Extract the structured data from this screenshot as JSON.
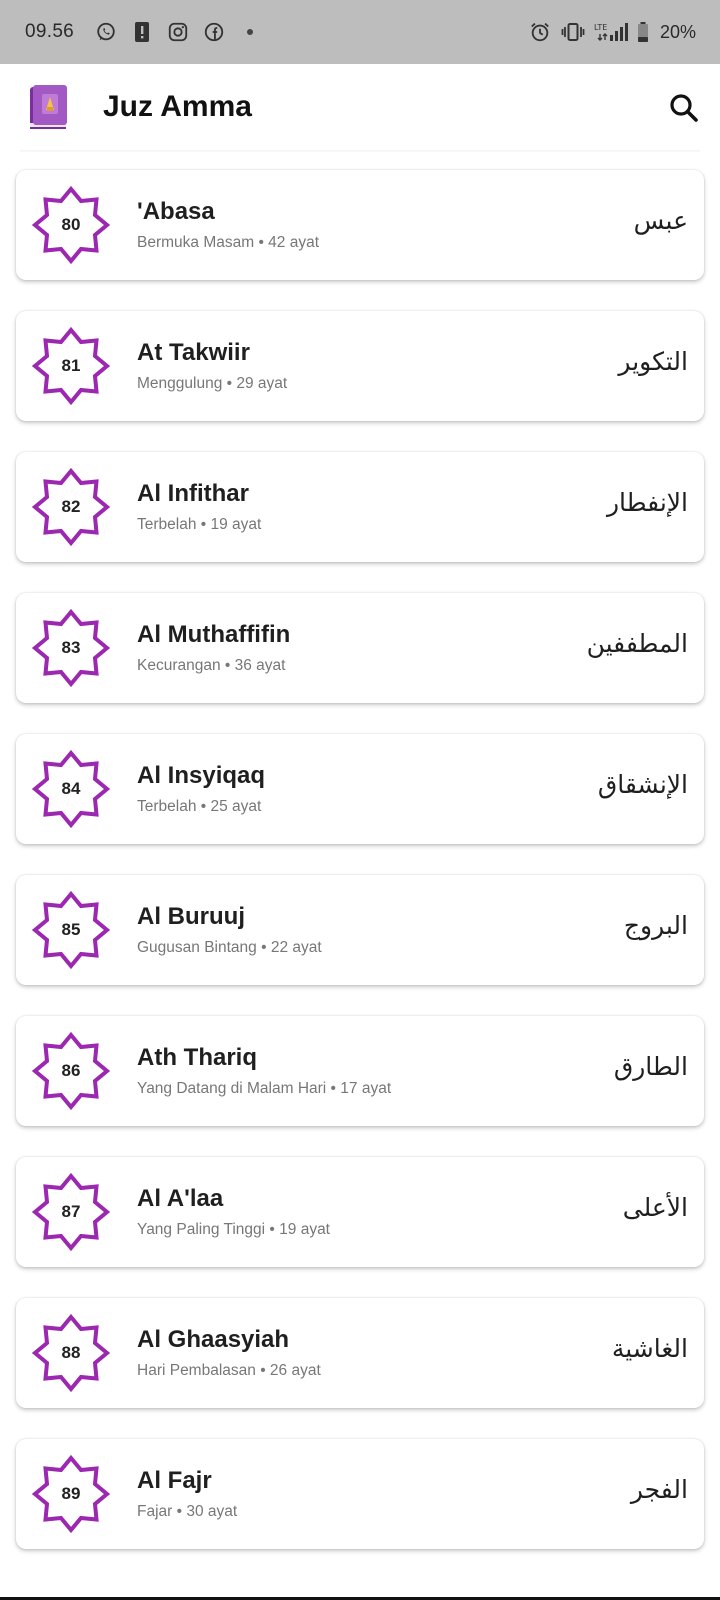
{
  "status_bar": {
    "time": "09.56",
    "left_icons": [
      "whatsapp-icon",
      "alert-icon",
      "instagram-icon",
      "facebook-icon",
      "dot-icon"
    ],
    "right_icons": [
      "alarm-icon",
      "vibrate-icon",
      "lte-signal-icon",
      "battery-icon"
    ],
    "network": "LTE",
    "battery": "20%"
  },
  "app_bar": {
    "title": "Juz Amma",
    "logo_icon": "quran-book-icon",
    "search_icon": "search-icon"
  },
  "colors": {
    "accent": "#9c27b0",
    "status_bar_bg": "#bdbdbd",
    "subtitle_text": "#777777"
  },
  "surahs": [
    {
      "number": "80",
      "name": "'Abasa",
      "subtitle": "Bermuka Masam • 42 ayat",
      "arabic": "عبس"
    },
    {
      "number": "81",
      "name": "At Takwiir",
      "subtitle": "Menggulung • 29 ayat",
      "arabic": "التكوير"
    },
    {
      "number": "82",
      "name": "Al Infithar",
      "subtitle": "Terbelah • 19 ayat",
      "arabic": "الإنفطار"
    },
    {
      "number": "83",
      "name": "Al Muthaffifin",
      "subtitle": "Kecurangan • 36 ayat",
      "arabic": "المطففين"
    },
    {
      "number": "84",
      "name": "Al Insyiqaq",
      "subtitle": "Terbelah • 25 ayat",
      "arabic": "الإنشقاق"
    },
    {
      "number": "85",
      "name": "Al Buruuj",
      "subtitle": "Gugusan Bintang • 22 ayat",
      "arabic": "البروج"
    },
    {
      "number": "86",
      "name": "Ath Thariq",
      "subtitle": "Yang Datang di Malam Hari • 17 ayat",
      "arabic": "الطارق"
    },
    {
      "number": "87",
      "name": "Al A'laa",
      "subtitle": "Yang Paling Tinggi • 19 ayat",
      "arabic": "الأعلى"
    },
    {
      "number": "88",
      "name": "Al Ghaasyiah",
      "subtitle": "Hari Pembalasan • 26 ayat",
      "arabic": "الغاشية"
    },
    {
      "number": "89",
      "name": "Al Fajr",
      "subtitle": "Fajar • 30 ayat",
      "arabic": "الفجر"
    }
  ]
}
